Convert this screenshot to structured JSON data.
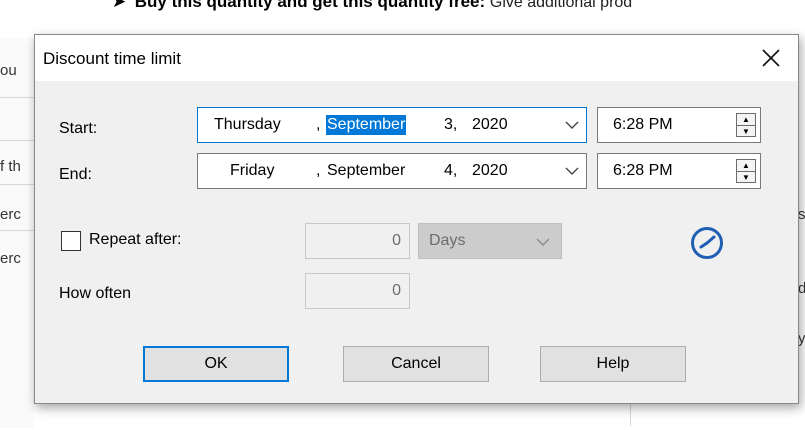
{
  "background": {
    "heading_bold": "Buy this quantity and get this quantity free:",
    "heading_desc": "Give additional prod",
    "frag_left_1": "ou",
    "frag_left_2": "f th",
    "frag_left_3": "erc",
    "frag_left_4": "erc",
    "frag_right_1": "s",
    "frag_right_2": "d",
    "frag_right_3": "y"
  },
  "dialog": {
    "title": "Discount time limit",
    "start": {
      "label": "Start:",
      "weekday": "Thursday",
      "sep1": ",",
      "month": "September",
      "day": "3,",
      "year": "2020",
      "time": "6:28 PM"
    },
    "end": {
      "label": "End:",
      "weekday": "Friday",
      "sep1": ",",
      "month": "September",
      "day": "4,",
      "year": "2020",
      "time": "6:28 PM"
    },
    "repeat": {
      "label": "Repeat after:",
      "checked": false,
      "value": "0",
      "unit": "Days"
    },
    "how_often": {
      "label": "How often",
      "value": "0"
    },
    "buttons": {
      "ok": "OK",
      "cancel": "Cancel",
      "help": "Help"
    }
  },
  "colors": {
    "accent": "#0078d7",
    "dialog_bg": "#f0f0f0",
    "button_bg": "#e1e1e1",
    "disabled_bg": "#cccccc"
  },
  "icons": {
    "close": "close-icon",
    "dropdown": "chevron-down-icon",
    "spinner": "spin-updown-icon",
    "clock": "clock-icon"
  }
}
